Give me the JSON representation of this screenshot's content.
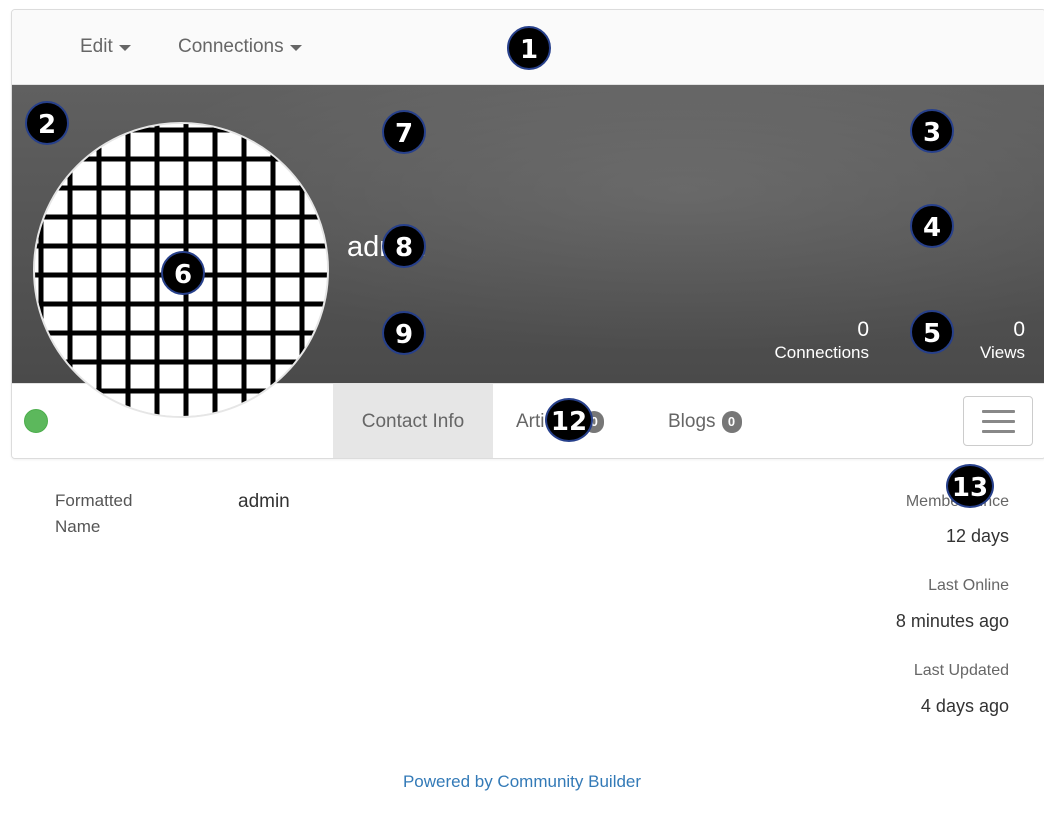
{
  "toolbar": {
    "edit_label": "Edit",
    "connections_label": "Connections"
  },
  "profile": {
    "username": "admin",
    "online_status_color": "#5cb85c",
    "stats": {
      "connections": {
        "value": "0",
        "label": "Connections"
      },
      "views": {
        "value": "0",
        "label": "Views"
      }
    }
  },
  "tabs": [
    {
      "label": "Contact Info",
      "active": true
    },
    {
      "label": "Articles",
      "badge": "0"
    },
    {
      "label": "Blogs",
      "badge": "0"
    }
  ],
  "contact": {
    "fields": [
      {
        "label": "Formatted Name",
        "value": "admin"
      }
    ]
  },
  "side_info": [
    {
      "label": "Member Since",
      "value": "12 days"
    },
    {
      "label": "Last Online",
      "value": "8 minutes ago"
    },
    {
      "label": "Last Updated",
      "value": "4 days ago"
    }
  ],
  "footer": {
    "text": "Powered by Community Builder"
  },
  "markers": [
    "1",
    "2",
    "3",
    "4",
    "5",
    "6",
    "7",
    "8",
    "9",
    "12",
    "13"
  ],
  "icons": {
    "avatar": "grid-pattern-avatar",
    "menu": "hamburger-icon",
    "caret": "caret-down-icon"
  }
}
